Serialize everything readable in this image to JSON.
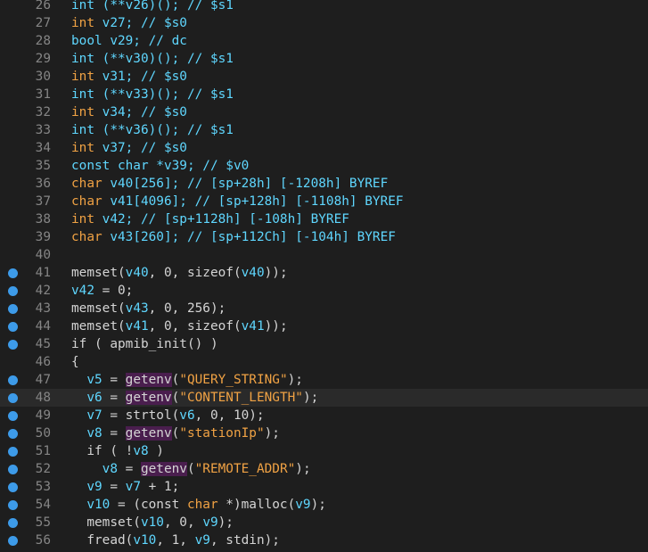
{
  "editor": {
    "lines": [
      {
        "num": "26",
        "bp": false,
        "hl": false,
        "tokens": [
          {
            "t": "int (**",
            "c": "t-cyan"
          },
          {
            "t": "v26",
            "c": "t-cyan"
          },
          {
            "t": ")(); // $s1",
            "c": "t-cyan"
          }
        ]
      },
      {
        "num": "27",
        "bp": false,
        "hl": false,
        "tokens": [
          {
            "t": "int ",
            "c": "t-type"
          },
          {
            "t": "v27",
            "c": "t-cyan"
          },
          {
            "t": "; // $s0",
            "c": "t-cyan"
          }
        ]
      },
      {
        "num": "28",
        "bp": false,
        "hl": false,
        "tokens": [
          {
            "t": "bool v29; // dc",
            "c": "t-cyan"
          }
        ]
      },
      {
        "num": "29",
        "bp": false,
        "hl": false,
        "tokens": [
          {
            "t": "int (**v30)(); // $s1",
            "c": "t-cyan"
          }
        ]
      },
      {
        "num": "30",
        "bp": false,
        "hl": false,
        "tokens": [
          {
            "t": "int ",
            "c": "t-type"
          },
          {
            "t": "v31; // $s0",
            "c": "t-cyan"
          }
        ]
      },
      {
        "num": "31",
        "bp": false,
        "hl": false,
        "tokens": [
          {
            "t": "int (**v33)(); // $s1",
            "c": "t-cyan"
          }
        ]
      },
      {
        "num": "32",
        "bp": false,
        "hl": false,
        "tokens": [
          {
            "t": "int ",
            "c": "t-type"
          },
          {
            "t": "v34; // $s0",
            "c": "t-cyan"
          }
        ]
      },
      {
        "num": "33",
        "bp": false,
        "hl": false,
        "tokens": [
          {
            "t": "int (**v36)(); // $s1",
            "c": "t-cyan"
          }
        ]
      },
      {
        "num": "34",
        "bp": false,
        "hl": false,
        "tokens": [
          {
            "t": "int ",
            "c": "t-type"
          },
          {
            "t": "v37; // $s0",
            "c": "t-cyan"
          }
        ]
      },
      {
        "num": "35",
        "bp": false,
        "hl": false,
        "tokens": [
          {
            "t": "const char *v39; // $v0",
            "c": "t-cyan"
          }
        ]
      },
      {
        "num": "36",
        "bp": false,
        "hl": false,
        "tokens": [
          {
            "t": "char ",
            "c": "t-type"
          },
          {
            "t": "v40[256]; // [sp+28h] [-1208h] BYREF",
            "c": "t-cyan"
          }
        ]
      },
      {
        "num": "37",
        "bp": false,
        "hl": false,
        "tokens": [
          {
            "t": "char ",
            "c": "t-type"
          },
          {
            "t": "v41[4096]; // [sp+128h] [-1108h] BYREF",
            "c": "t-cyan"
          }
        ]
      },
      {
        "num": "38",
        "bp": false,
        "hl": false,
        "tokens": [
          {
            "t": "int ",
            "c": "t-type"
          },
          {
            "t": "v42; // [sp+1128h] [-108h] BYREF",
            "c": "t-cyan"
          }
        ]
      },
      {
        "num": "39",
        "bp": false,
        "hl": false,
        "tokens": [
          {
            "t": "char ",
            "c": "t-type"
          },
          {
            "t": "v43[260]; // [sp+112Ch] [-104h] BYREF",
            "c": "t-cyan"
          }
        ]
      },
      {
        "num": "40",
        "bp": false,
        "hl": false,
        "tokens": []
      },
      {
        "num": "41",
        "bp": true,
        "hl": false,
        "tokens": [
          {
            "t": "memset(",
            "c": "t-id"
          },
          {
            "t": "v40",
            "c": "t-cyan"
          },
          {
            "t": ", 0, sizeof(",
            "c": "t-id"
          },
          {
            "t": "v40",
            "c": "t-cyan"
          },
          {
            "t": "));",
            "c": "t-id"
          }
        ]
      },
      {
        "num": "42",
        "bp": true,
        "hl": false,
        "tokens": [
          {
            "t": "v42",
            "c": "t-cyan"
          },
          {
            "t": " = 0;",
            "c": "t-id"
          }
        ]
      },
      {
        "num": "43",
        "bp": true,
        "hl": false,
        "tokens": [
          {
            "t": "memset(",
            "c": "t-id"
          },
          {
            "t": "v43",
            "c": "t-cyan"
          },
          {
            "t": ", 0, 256);",
            "c": "t-id"
          }
        ]
      },
      {
        "num": "44",
        "bp": true,
        "hl": false,
        "tokens": [
          {
            "t": "memset(",
            "c": "t-id"
          },
          {
            "t": "v41",
            "c": "t-cyan"
          },
          {
            "t": ", 0, sizeof(",
            "c": "t-id"
          },
          {
            "t": "v41",
            "c": "t-cyan"
          },
          {
            "t": "));",
            "c": "t-id"
          }
        ]
      },
      {
        "num": "45",
        "bp": true,
        "hl": false,
        "tokens": [
          {
            "t": "if ( apmib_init() )",
            "c": "t-id"
          }
        ]
      },
      {
        "num": "46",
        "bp": false,
        "hl": false,
        "tokens": [
          {
            "t": "{",
            "c": "t-id"
          }
        ]
      },
      {
        "num": "47",
        "bp": true,
        "hl": false,
        "tokens": [
          {
            "t": "  ",
            "c": "t-id"
          },
          {
            "t": "v5",
            "c": "t-cyan"
          },
          {
            "t": " = ",
            "c": "t-id"
          },
          {
            "t": "getenv",
            "c": "t-fn"
          },
          {
            "t": "(",
            "c": "t-id"
          },
          {
            "t": "\"QUERY_STRING\"",
            "c": "t-str"
          },
          {
            "t": ");",
            "c": "t-id"
          }
        ]
      },
      {
        "num": "48",
        "bp": true,
        "hl": true,
        "tokens": [
          {
            "t": "  ",
            "c": "t-id"
          },
          {
            "t": "v6",
            "c": "t-cyan"
          },
          {
            "t": " = ",
            "c": "t-id"
          },
          {
            "t": "getenv",
            "c": "t-fn"
          },
          {
            "t": "(",
            "c": "t-id"
          },
          {
            "t": "\"CONTENT_LENGTH\"",
            "c": "t-str"
          },
          {
            "t": ");",
            "c": "t-id"
          }
        ]
      },
      {
        "num": "49",
        "bp": true,
        "hl": false,
        "tokens": [
          {
            "t": "  ",
            "c": "t-id"
          },
          {
            "t": "v7",
            "c": "t-cyan"
          },
          {
            "t": " = strtol(",
            "c": "t-id"
          },
          {
            "t": "v6",
            "c": "t-cyan"
          },
          {
            "t": ", 0, 10);",
            "c": "t-id"
          }
        ]
      },
      {
        "num": "50",
        "bp": true,
        "hl": false,
        "tokens": [
          {
            "t": "  ",
            "c": "t-id"
          },
          {
            "t": "v8",
            "c": "t-cyan"
          },
          {
            "t": " = ",
            "c": "t-id"
          },
          {
            "t": "getenv",
            "c": "t-fn"
          },
          {
            "t": "(",
            "c": "t-id"
          },
          {
            "t": "\"stationIp\"",
            "c": "t-str"
          },
          {
            "t": ");",
            "c": "t-id"
          }
        ]
      },
      {
        "num": "51",
        "bp": true,
        "hl": false,
        "tokens": [
          {
            "t": "  if ( !",
            "c": "t-id"
          },
          {
            "t": "v8",
            "c": "t-cyan"
          },
          {
            "t": " )",
            "c": "t-id"
          }
        ]
      },
      {
        "num": "52",
        "bp": true,
        "hl": false,
        "tokens": [
          {
            "t": "    ",
            "c": "t-id"
          },
          {
            "t": "v8",
            "c": "t-cyan"
          },
          {
            "t": " = ",
            "c": "t-id"
          },
          {
            "t": "getenv",
            "c": "t-fn"
          },
          {
            "t": "(",
            "c": "t-id"
          },
          {
            "t": "\"REMOTE_ADDR\"",
            "c": "t-str"
          },
          {
            "t": ");",
            "c": "t-id"
          }
        ]
      },
      {
        "num": "53",
        "bp": true,
        "hl": false,
        "tokens": [
          {
            "t": "  ",
            "c": "t-id"
          },
          {
            "t": "v9",
            "c": "t-cyan"
          },
          {
            "t": " = ",
            "c": "t-id"
          },
          {
            "t": "v7",
            "c": "t-cyan"
          },
          {
            "t": " + 1;",
            "c": "t-id"
          }
        ]
      },
      {
        "num": "54",
        "bp": true,
        "hl": false,
        "tokens": [
          {
            "t": "  ",
            "c": "t-id"
          },
          {
            "t": "v10",
            "c": "t-cyan"
          },
          {
            "t": " = (const ",
            "c": "t-id"
          },
          {
            "t": "char",
            "c": "t-type"
          },
          {
            "t": " *)malloc(",
            "c": "t-id"
          },
          {
            "t": "v9",
            "c": "t-cyan"
          },
          {
            "t": ");",
            "c": "t-id"
          }
        ]
      },
      {
        "num": "55",
        "bp": true,
        "hl": false,
        "tokens": [
          {
            "t": "  memset(",
            "c": "t-id"
          },
          {
            "t": "v10",
            "c": "t-cyan"
          },
          {
            "t": ", 0, ",
            "c": "t-id"
          },
          {
            "t": "v9",
            "c": "t-cyan"
          },
          {
            "t": ");",
            "c": "t-id"
          }
        ]
      },
      {
        "num": "56",
        "bp": true,
        "hl": false,
        "tokens": [
          {
            "t": "  fread(",
            "c": "t-id"
          },
          {
            "t": "v10",
            "c": "t-cyan"
          },
          {
            "t": ", 1, ",
            "c": "t-id"
          },
          {
            "t": "v9",
            "c": "t-cyan"
          },
          {
            "t": ", stdin);",
            "c": "t-id"
          }
        ]
      }
    ]
  }
}
